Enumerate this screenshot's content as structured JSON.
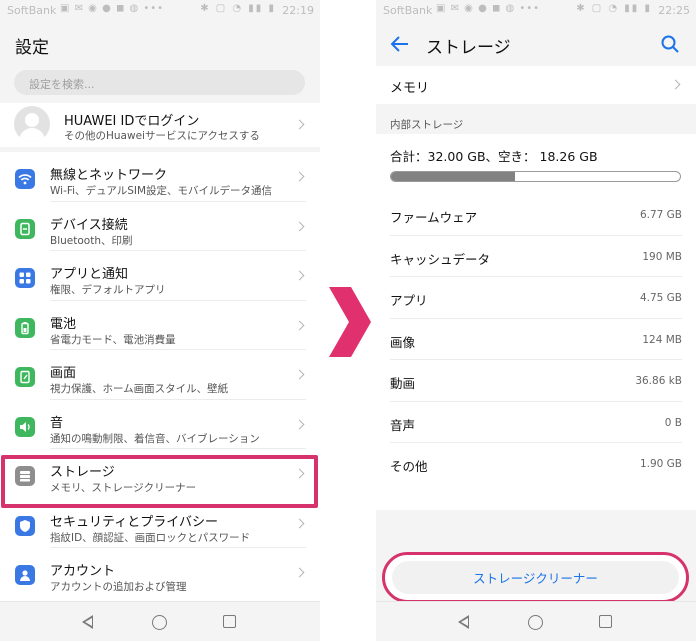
{
  "status_bar": {
    "carrier": "SoftBank",
    "time_left": "22:19",
    "time_right": "22:25"
  },
  "settings_screen": {
    "title": "設定",
    "search_placeholder": "設定を検索...",
    "account": {
      "title": "HUAWEI IDでログイン",
      "subtitle": "その他のHuaweiサービスにアクセスする"
    },
    "items": [
      {
        "title": "無線とネットワーク",
        "subtitle": "Wi-Fi、デュアルSIM設定、モバイルデータ通信",
        "icon": "wifi-icon",
        "color": "#3a78e3"
      },
      {
        "title": "デバイス接続",
        "subtitle": "Bluetooth、印刷",
        "icon": "device-connect-icon",
        "color": "#3fb75e"
      },
      {
        "title": "アプリと通知",
        "subtitle": "権限、デフォルトアプリ",
        "icon": "apps-icon",
        "color": "#3a78e3"
      },
      {
        "title": "電池",
        "subtitle": "省電力モード、電池消費量",
        "icon": "battery-icon",
        "color": "#3fb75e"
      },
      {
        "title": "画面",
        "subtitle": "視力保護、ホーム画面スタイル、壁紙",
        "icon": "display-icon",
        "color": "#3fb75e"
      },
      {
        "title": "音",
        "subtitle": "通知の鳴動制限、着信音、バイブレーション",
        "icon": "sound-icon",
        "color": "#3fb75e"
      },
      {
        "title": "ストレージ",
        "subtitle": "メモリ、ストレージクリーナー",
        "icon": "storage-icon",
        "color": "#8e8e8e"
      },
      {
        "title": "セキュリティとプライバシー",
        "subtitle": "指紋ID、顔認証、画面ロックとパスワード",
        "icon": "shield-icon",
        "color": "#3a78e3"
      },
      {
        "title": "アカウント",
        "subtitle": "アカウントの追加および管理",
        "icon": "account-icon",
        "color": "#3a78e3"
      }
    ]
  },
  "storage_screen": {
    "title": "ストレージ",
    "memory_label": "メモリ",
    "section_label": "内部ストレージ",
    "total_text": "合計：32.00 GB、空き： 18.26 GB",
    "usage_fraction": 0.43,
    "rows": [
      {
        "label": "ファームウェア",
        "value": "6.77 GB"
      },
      {
        "label": "キャッシュデータ",
        "value": "190 MB"
      },
      {
        "label": "アプリ",
        "value": "4.75 GB"
      },
      {
        "label": "画像",
        "value": "124 MB"
      },
      {
        "label": "動画",
        "value": "36.86 kB"
      },
      {
        "label": "音声",
        "value": "0 B"
      },
      {
        "label": "その他",
        "value": "1.90 GB"
      }
    ],
    "cleaner_button": "ストレージクリーナー"
  },
  "colors": {
    "highlight": "#d6336c",
    "accent": "#1a73e8"
  }
}
